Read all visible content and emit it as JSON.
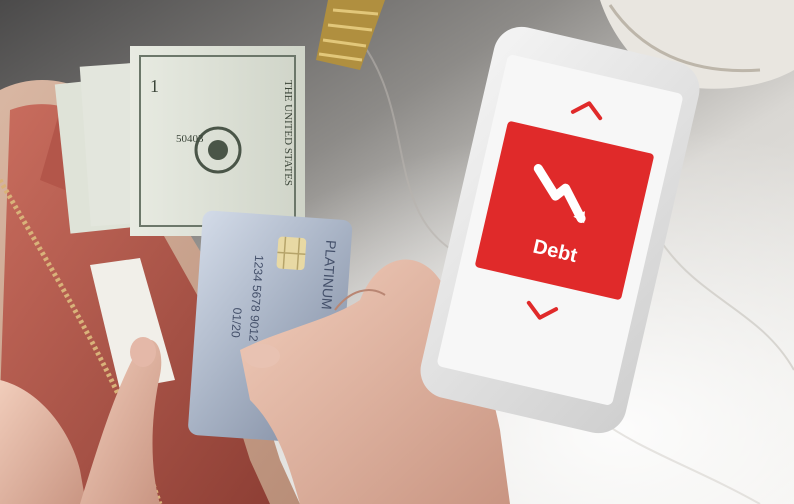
{
  "phone": {
    "tile_label": "Debt",
    "up_arrow_icon": "chevron-up-icon",
    "down_arrow_icon": "chevron-down-icon",
    "trend_icon": "trending-down-icon",
    "accent": "#e02a2a"
  },
  "card": {
    "brand": "PLATINUM",
    "number": "1234 5678 9012 3",
    "expiry": "01/20"
  },
  "bill": {
    "serial": "50403",
    "text": "THE UNITED STATES",
    "denomination": "1"
  }
}
